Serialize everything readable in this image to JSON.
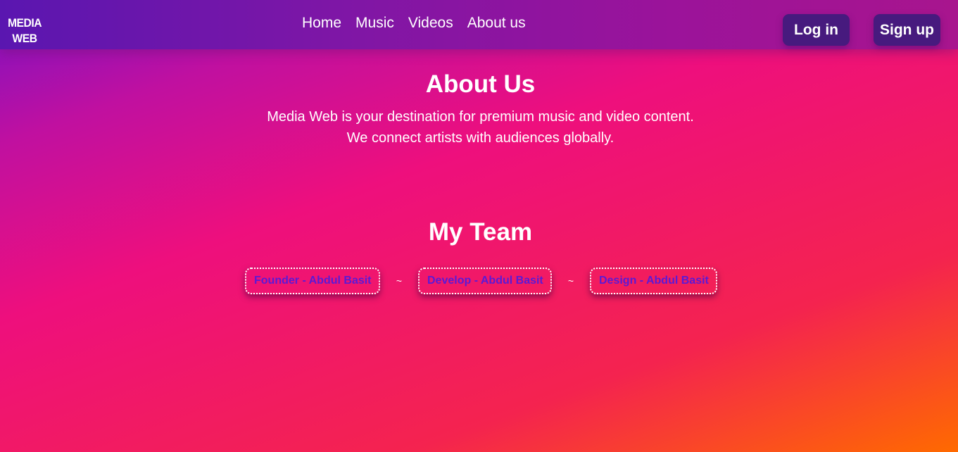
{
  "nav": {
    "logo_line1": "MEDIA",
    "logo_line2": "WEB",
    "links": [
      "Home",
      "Music",
      "Videos",
      "About us"
    ],
    "login_label": "Log in",
    "signup_label": "Sign up"
  },
  "about": {
    "title": "About Us",
    "line1": "Media Web is your destination for premium music and video content.",
    "line2": "We connect artists with audiences globally."
  },
  "team": {
    "title": "My Team",
    "members": [
      "Founder - Abdul Basit",
      "Develop - Abdul Basit",
      "Design - Abdul Basit"
    ],
    "separator": "~"
  },
  "colors": {
    "nav_button_bg": "#471a7e",
    "member_text": "#5b1ad6",
    "gradient_start": "#7a12c4",
    "gradient_mid": "#ee0f7d",
    "gradient_end": "#ff6a00"
  }
}
